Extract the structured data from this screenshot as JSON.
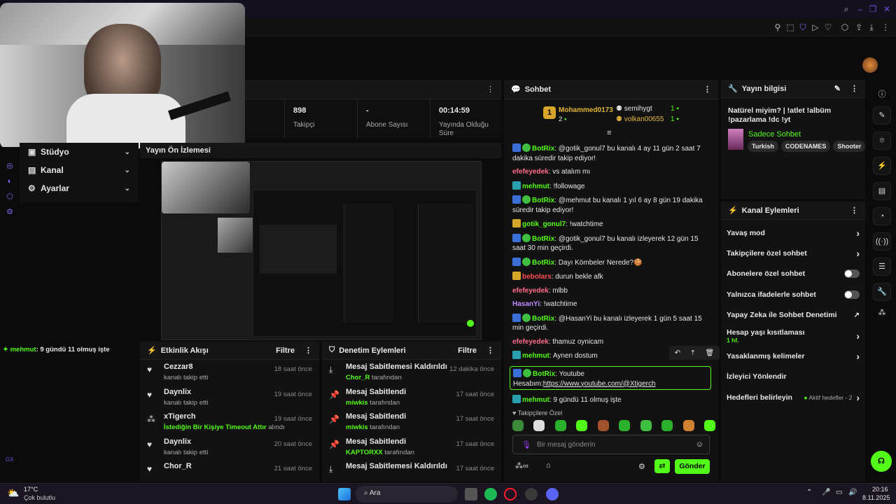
{
  "stats": {
    "followers_value": "898",
    "followers_label": "Takipçi",
    "subs_value": "-",
    "subs_label": "Abone Sayısı",
    "uptime_value": "00:14:59",
    "uptime_label": "Yayında Olduğu Süre"
  },
  "leftmenu": [
    {
      "label": "Stüdyo"
    },
    {
      "label": "Kanal"
    },
    {
      "label": "Ayarlar"
    }
  ],
  "preview_title": "Yayın Ön İzlemesi",
  "overlay_chat": {
    "user": "mehmut",
    "text": ": 9 gündü 11 olmuş işte"
  },
  "activity": {
    "title": "Etkinlik Akışı",
    "filter": "Filtre",
    "items": [
      {
        "name": "Cezzar8",
        "sub": "kanalı takip etti",
        "time": "18 saat önce"
      },
      {
        "name": "Daynlix",
        "sub": "kanalı takip etti",
        "time": "19 saat önce"
      },
      {
        "name": "xTigerch",
        "sub_strong": "İstediğin Bir Kişiye Timeout Attır",
        "sub": " alındı",
        "time": "19 saat önce"
      },
      {
        "name": "Daynlix",
        "sub": "kanalı takip etti",
        "time": "20 saat önce"
      },
      {
        "name": "Chor_R",
        "sub": "",
        "time": "21 saat önce"
      }
    ]
  },
  "moderation": {
    "title": "Denetim Eylemleri",
    "filter": "Filtre",
    "items": [
      {
        "name": "Mesaj Sabitlemesi Kaldırıldı",
        "user": "Chor_R",
        "sub": " tarafından",
        "time": "12 dakika önce"
      },
      {
        "name": "Mesaj Sabitlendi",
        "user": "miwkis",
        "sub": " tarafından",
        "time": "17 saat önce"
      },
      {
        "name": "Mesaj Sabitlendi",
        "user": "miwkis",
        "sub": " tarafından",
        "time": "17 saat önce"
      },
      {
        "name": "Mesaj Sabitlendi",
        "user": "KAPTORXX",
        "sub": " tarafından",
        "time": "17 saat önce"
      },
      {
        "name": "Mesaj Sabitlemesi Kaldırıldı",
        "user": "",
        "sub": "",
        "time": "17 saat önce"
      }
    ]
  },
  "chat": {
    "title": "Sohbet",
    "top_gifter": "Mohammed0173",
    "top_gifter_count": "2",
    "gifter2": "semihygt",
    "gifter2_count": "1",
    "gifter3": "volkan00655",
    "gifter3_count": "1",
    "messages": [
      {
        "user": "BotRix",
        "color": "#53fc18",
        "badges": [
          "bot",
          "ver"
        ],
        "text": ": @gotik_gonul7 bu kanalı 4 ay 11 gün 2 saat 7 dakika süredir takip ediyor!"
      },
      {
        "user": "efefeyedek",
        "color": "#ff6b8a",
        "badges": [],
        "text": ": vs atalım mı"
      },
      {
        "user": "mehmut",
        "color": "#53fc18",
        "badges": [
          "sub"
        ],
        "text": ": !followage"
      },
      {
        "user": "BotRix",
        "color": "#53fc18",
        "badges": [
          "bot",
          "ver"
        ],
        "text": ": @mehmut bu kanalı 1 yıl 6 ay 8 gün 19 dakika süredir takip ediyor!"
      },
      {
        "user": "gotik_gonul7",
        "color": "#53fc18",
        "badges": [
          "crown"
        ],
        "text": ": !watchtime"
      },
      {
        "user": "BotRix",
        "color": "#53fc18",
        "badges": [
          "bot",
          "ver"
        ],
        "text": ": @gotik_gonul7 bu kanalı izleyerek 12 gün 15 saat 30 min geçirdi."
      },
      {
        "user": "BotRix",
        "color": "#53fc18",
        "badges": [
          "bot",
          "ver"
        ],
        "text": ": Dayı Kömbeler Nerede?🍪"
      },
      {
        "user": "bebolars",
        "color": "#ff4d4d",
        "badges": [
          "crown"
        ],
        "text": ": durun bekle afk"
      },
      {
        "user": "efefeyedek",
        "color": "#ff6b8a",
        "badges": [],
        "text": ": mlbb"
      },
      {
        "user": "HasanYi",
        "color": "#c38bff",
        "badges": [],
        "text": ": !watchtime"
      },
      {
        "user": "BotRix",
        "color": "#53fc18",
        "badges": [
          "bot",
          "ver"
        ],
        "text": ": @HasanYi bu kanalı izleyerek 1 gün 5 saat 15 min geçirdi."
      },
      {
        "user": "efefeyedek",
        "color": "#ff6b8a",
        "badges": [],
        "text": ": thamuz oynicam"
      },
      {
        "user": "mehmut",
        "color": "#53fc18",
        "badges": [
          "sub"
        ],
        "text": ": Aynen dostum"
      }
    ],
    "pinned": {
      "user": "BotRix",
      "text": ": Youtube",
      "text2": "Hesabım:",
      "link": "https://www.youtube.com/@Xtigerch"
    },
    "last": {
      "user": "mehmut",
      "text": ": 9 gündü 11 olmuş işte"
    },
    "emote_label": "Takipçilere Özel",
    "input_placeholder": "Bir mesaj gönderin",
    "send_label": "Gönder"
  },
  "stream_info": {
    "title": "Yayın bilgisi",
    "stream_title": "Natürel miyim? | !atlet !albüm !pazarlama !dc !yt",
    "category": "Sadece Sohbet",
    "tags": [
      "Turkish",
      "CODENAMES",
      "Shooter"
    ]
  },
  "channel_actions": {
    "title": "Kanal Eylemleri",
    "items": [
      {
        "label": "Yavaş mod",
        "kind": "chev"
      },
      {
        "label": "Takipçilere özel sohbet",
        "kind": "chev"
      },
      {
        "label": "Abonelere özel sohbet",
        "kind": "toggle"
      },
      {
        "label": "Yalnızca ifadelerle sohbet",
        "kind": "toggle"
      },
      {
        "label": "Yapay Zeka ile Sohbet Denetimi",
        "kind": "ext"
      },
      {
        "label": "Hesap yaşı kısıtlaması",
        "sub": "1 hf.",
        "kind": "chev"
      },
      {
        "label": "Yasaklanmış kelimeler",
        "kind": "chev"
      },
      {
        "label": "İzleyici Yönlendir",
        "kind": ""
      },
      {
        "label": "Hedefleri belirleyin",
        "extra": "Aktif hedefler - 2",
        "kind": "chev"
      }
    ]
  },
  "taskbar": {
    "weather_temp": "17°C",
    "weather_desc": "Çok bulutlu",
    "search": "Ara",
    "time": "20:16",
    "date": "8.11.2025"
  },
  "colors": {
    "accent": "#53fc18",
    "bg": "#0b0b0c",
    "panel": "#121212"
  }
}
